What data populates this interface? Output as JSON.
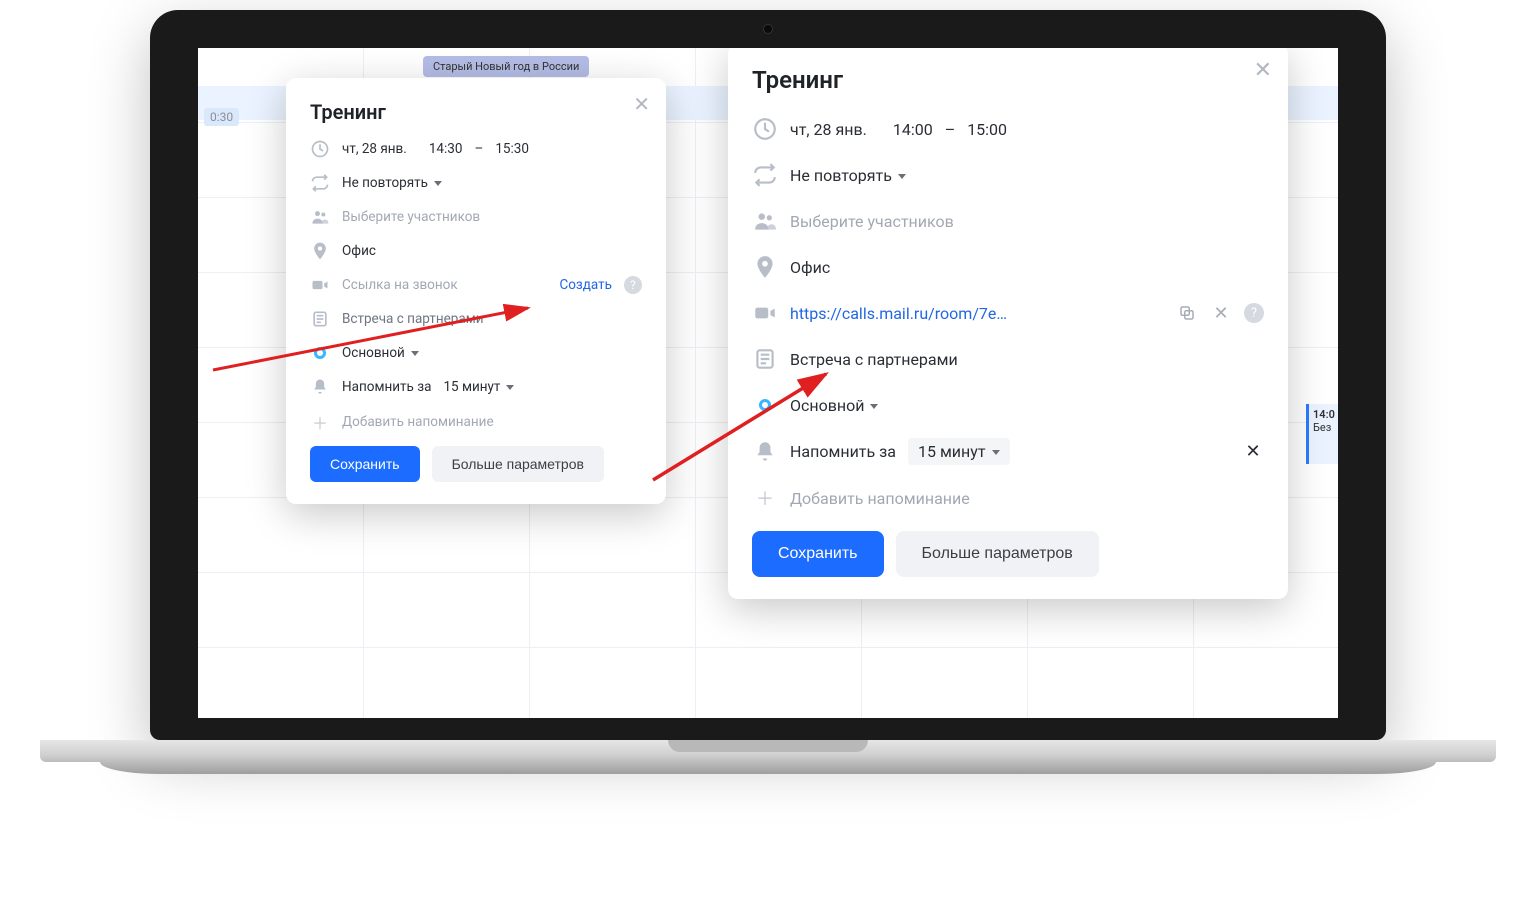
{
  "calendar": {
    "holiday_label": "Старый Новый год в России",
    "time_label": "0:30",
    "side_event": {
      "time": "14:0",
      "title": "Без"
    }
  },
  "dialog_small": {
    "title": "Тренинг",
    "date": "чт, 28 янв.",
    "time_start": "14:30",
    "time_sep": "–",
    "time_end": "15:30",
    "repeat": "Не повторять",
    "participants_placeholder": "Выберите участников",
    "location": "Офис",
    "call_link_label": "Ссылка на звонок",
    "create_link": "Создать",
    "description": "Встреча с партнерами",
    "calendar_name": "Основной",
    "reminder_prefix": "Напомнить за",
    "reminder_value": "15 минут",
    "add_reminder": "Добавить напоминание",
    "save": "Сохранить",
    "more": "Больше параметров"
  },
  "dialog_large": {
    "title": "Тренинг",
    "date": "чт, 28 янв.",
    "time_start": "14:00",
    "time_sep": "–",
    "time_end": "15:00",
    "repeat": "Не повторять",
    "participants_placeholder": "Выберите участников",
    "location": "Офис",
    "call_url": "https://calls.mail.ru/room/7e…",
    "description": "Встреча с партнерами",
    "calendar_name": "Основной",
    "reminder_prefix": "Напомнить за",
    "reminder_value": "15 минут",
    "add_reminder": "Добавить напоминание",
    "save": "Сохранить",
    "more": "Больше параметров"
  }
}
